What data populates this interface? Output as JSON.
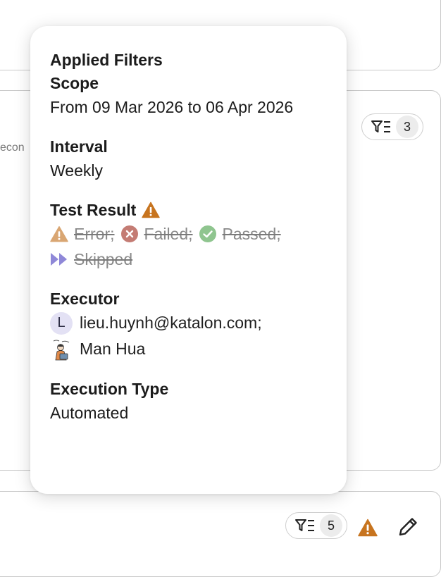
{
  "background": {
    "partial_text": "econ",
    "filter_chip_top_count": "3",
    "filter_chip_bottom_count": "5"
  },
  "popover": {
    "title": "Applied Filters",
    "scope": {
      "label": "Scope",
      "value": "From 09 Mar 2026 to 06 Apr 2026"
    },
    "interval": {
      "label": "Interval",
      "value": "Weekly"
    },
    "test_result": {
      "label": "Test Result",
      "items": [
        {
          "label": "Error;",
          "icon": "warning-icon",
          "color": "#d9a673"
        },
        {
          "label": "Failed;",
          "icon": "x-circle-icon",
          "color": "#c47c74"
        },
        {
          "label": "Passed;",
          "icon": "check-circle-icon",
          "color": "#8fc58f"
        },
        {
          "label": "Skipped",
          "icon": "skip-icon",
          "color": "#8f88d8"
        }
      ]
    },
    "executor": {
      "label": "Executor",
      "users": [
        {
          "avatar_letter": "L",
          "name": "lieu.huynh@katalon.com;"
        },
        {
          "avatar_letter": "",
          "name": "Man Hua"
        }
      ]
    },
    "execution_type": {
      "label": "Execution Type",
      "value": "Automated"
    }
  },
  "colors": {
    "warning": "#c7741f",
    "avatar_bg": "#e3e1f4"
  }
}
